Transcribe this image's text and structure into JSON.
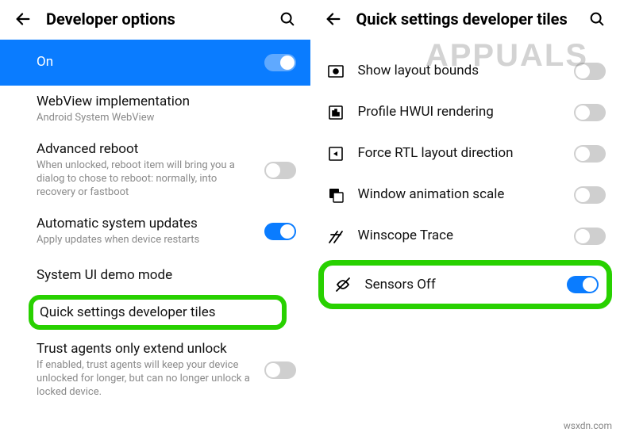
{
  "left": {
    "header": {
      "title": "Developer options"
    },
    "rows": {
      "on": {
        "label": "On"
      },
      "webview": {
        "label": "WebView implementation",
        "sub": "Android System WebView"
      },
      "adv_reboot": {
        "label": "Advanced reboot",
        "sub": "When unlocked, reboot item will bring you a dialog to chose to reboot: normally, into recovery or fastboot"
      },
      "auto_update": {
        "label": "Automatic system updates",
        "sub": "Apply updates when device restarts"
      },
      "sysui": {
        "label": "System UI demo mode"
      },
      "qstiles": {
        "label": "Quick settings developer tiles"
      },
      "trust": {
        "label": "Trust agents only extend unlock",
        "sub": "If enabled, trust agents will keep your device unlocked for longer, but can no longer unlock a locked device."
      }
    }
  },
  "right": {
    "header": {
      "title": "Quick settings developer tiles"
    },
    "rows": {
      "layout": {
        "label": "Show layout bounds"
      },
      "hwui": {
        "label": "Profile HWUI rendering"
      },
      "rtl": {
        "label": "Force RTL layout direction"
      },
      "anim": {
        "label": "Window animation scale"
      },
      "winscope": {
        "label": "Winscope Trace"
      },
      "sensors": {
        "label": "Sensors Off"
      }
    }
  },
  "watermark": "APPUALS",
  "footer": "wsxdn.com"
}
